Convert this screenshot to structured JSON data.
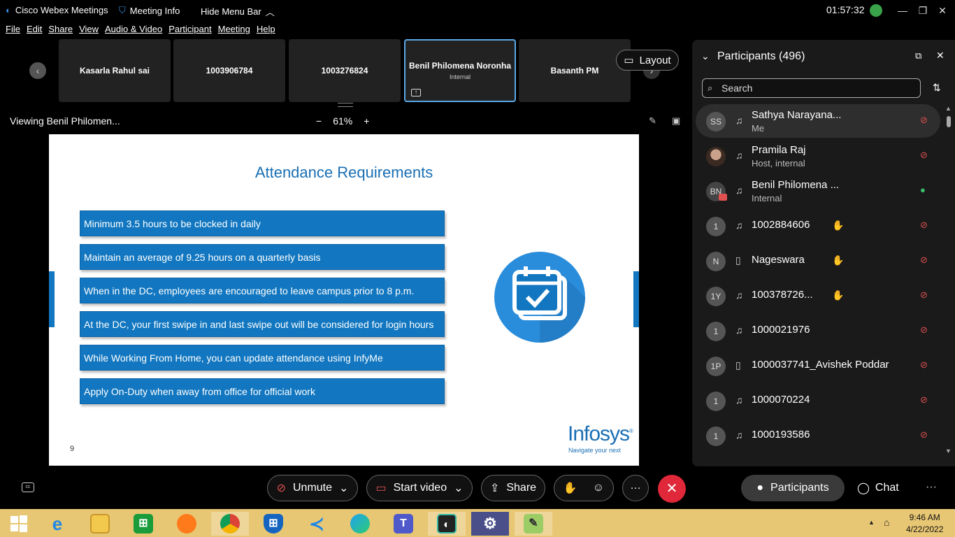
{
  "titlebar": {
    "app_name": "Cisco Webex Meetings",
    "meeting_info": "Meeting Info",
    "hide_menu": "Hide Menu Bar",
    "clock": "01:57:32"
  },
  "menubar": [
    "File",
    "Edit",
    "Share",
    "View",
    "Audio & Video",
    "Participant",
    "Meeting",
    "Help"
  ],
  "video_strip": {
    "tiles": [
      {
        "name": "Kasarla Rahul sai",
        "sub": ""
      },
      {
        "name": "1003906784",
        "sub": ""
      },
      {
        "name": "1003276824",
        "sub": ""
      },
      {
        "name": "Benil Philomena Noronha",
        "sub": "Internal",
        "active": true
      },
      {
        "name": "Basanth PM",
        "sub": ""
      }
    ],
    "layout_label": "Layout"
  },
  "viewbar": {
    "viewing": "Viewing Benil Philomen...",
    "zoom_minus": "−",
    "zoom": "61%",
    "zoom_plus": "+"
  },
  "slide": {
    "title": "Attendance Requirements",
    "bullets": [
      "Minimum 3.5 hours to be clocked in daily",
      "Maintain an average of 9.25 hours on a quarterly basis",
      "When in the DC, employees are encouraged to leave campus prior to 8 p.m.",
      "At the DC, your first swipe in and last swipe out will be considered for login hours",
      "While Working From Home, you can update attendance using InfyMe",
      "Apply On-Duty when away from office for official work"
    ],
    "page_number": "9",
    "logo_text": "Infosys",
    "logo_mark": "®",
    "tagline": "Navigate your next"
  },
  "participants_panel": {
    "title": "Participants (496)",
    "search_placeholder": "Search",
    "rows": [
      {
        "initials": "SS",
        "name": "Sathya Narayana...",
        "sub": "Me",
        "device": "headset",
        "hand": false,
        "mic": "muted"
      },
      {
        "initials": "",
        "name": "Pramila Raj",
        "sub": "Host, internal",
        "device": "headset",
        "hand": false,
        "mic": "muted"
      },
      {
        "initials": "BN",
        "name": "Benil Philomena ...",
        "sub": "Internal",
        "device": "headset",
        "hand": false,
        "mic": "on"
      },
      {
        "initials": "1",
        "name": "1002884606",
        "sub": "",
        "device": "headset",
        "hand": true,
        "mic": "muted"
      },
      {
        "initials": "N",
        "name": "Nageswara",
        "sub": "",
        "device": "phone",
        "hand": true,
        "mic": "muted"
      },
      {
        "initials": "1Y",
        "name": "100378726...",
        "sub": "",
        "device": "headset",
        "hand": true,
        "mic": "muted"
      },
      {
        "initials": "1",
        "name": "1000021976",
        "sub": "",
        "device": "headset",
        "hand": false,
        "mic": "muted"
      },
      {
        "initials": "1P",
        "name": "1000037741_Avishek Poddar",
        "sub": "",
        "device": "phone",
        "hand": false,
        "mic": "muted"
      },
      {
        "initials": "1",
        "name": "1000070224",
        "sub": "",
        "device": "headset",
        "hand": false,
        "mic": "muted"
      },
      {
        "initials": "1",
        "name": "1000193586",
        "sub": "",
        "device": "headset",
        "hand": false,
        "mic": "muted"
      }
    ]
  },
  "controls": {
    "unmute": "Unmute",
    "start_video": "Start video",
    "share": "Share",
    "participants": "Participants",
    "chat": "Chat"
  },
  "taskbar": {
    "time": "9:46 AM",
    "date": "4/22/2022",
    "apps": [
      "windows-start",
      "internet-explorer",
      "file-explorer",
      "microsoft-store",
      "firefox",
      "chrome",
      "defender",
      "vscode",
      "edge",
      "teams",
      "webex",
      "settings",
      "notepad-plus"
    ]
  },
  "colors": {
    "accent": "#5aa8e6",
    "slide_blue": "#1277c0",
    "end_call": "#e0283a",
    "mic_muted": "#e05050",
    "mic_on": "#3ac06a",
    "taskbar": "#e8c774"
  }
}
